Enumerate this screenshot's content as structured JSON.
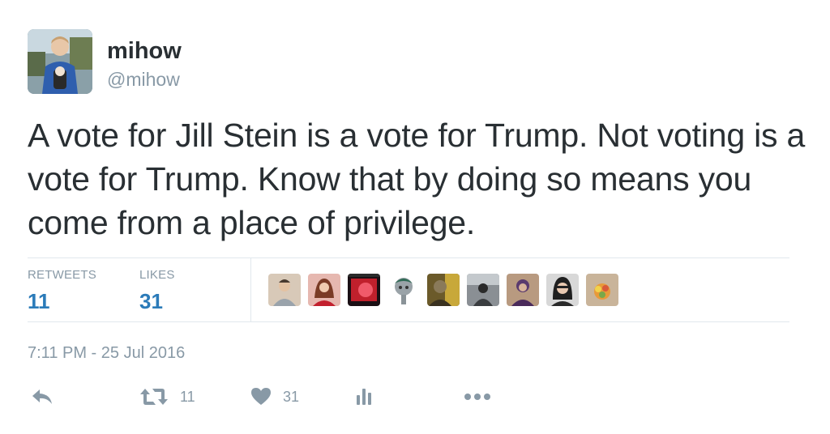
{
  "user": {
    "display_name": "mihow",
    "handle": "@mihow"
  },
  "tweet": {
    "text": "A vote for Jill Stein is a vote for Trump. Not voting is a vote for Trump. Know that by doing so means you come from a place of privilege.",
    "timestamp": "7:11 PM - 25 Jul 2016"
  },
  "stats": {
    "retweets_label": "RETWEETS",
    "retweets_count": "11",
    "likes_label": "LIKES",
    "likes_count": "31"
  },
  "actions": {
    "retweet_count": "11",
    "like_count": "31",
    "icons": [
      "reply-icon",
      "retweet-icon",
      "heart-icon",
      "analytics-icon",
      "more-icon"
    ]
  },
  "likers_count": 9,
  "colors": {
    "text": "#292f33",
    "muted": "#8899a6",
    "accent": "#2b7bb9",
    "divider": "#e1e8ed"
  }
}
